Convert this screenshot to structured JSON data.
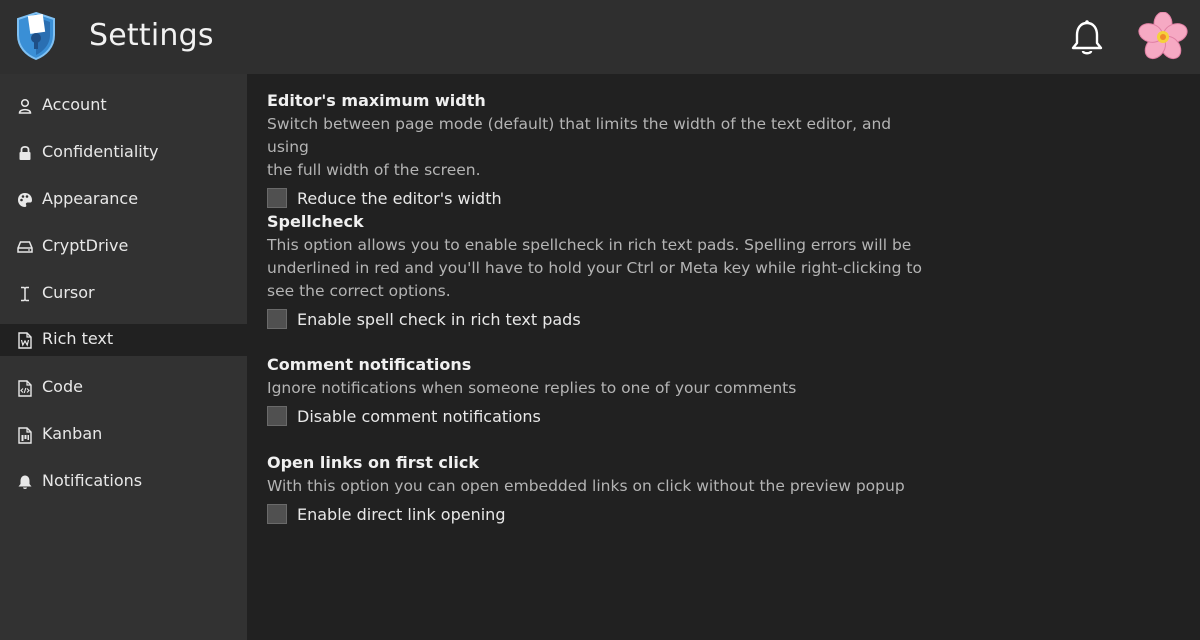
{
  "header": {
    "title": "Settings",
    "logo_icon": "cryptpad-shield-icon",
    "notifications_icon": "bell-icon",
    "avatar_icon": "cherry-blossom-avatar"
  },
  "sidebar": {
    "active_index": 5,
    "items": [
      {
        "label": "Account",
        "icon": "user-icon"
      },
      {
        "label": "Confidentiality",
        "icon": "lock-icon"
      },
      {
        "label": "Appearance",
        "icon": "palette-icon"
      },
      {
        "label": "CryptDrive",
        "icon": "drive-icon"
      },
      {
        "label": "Cursor",
        "icon": "text-cursor-icon"
      },
      {
        "label": "Rich text",
        "icon": "rich-text-file-icon"
      },
      {
        "label": "Code",
        "icon": "code-file-icon"
      },
      {
        "label": "Kanban",
        "icon": "kanban-file-icon"
      },
      {
        "label": "Notifications",
        "icon": "bell-icon"
      }
    ]
  },
  "main": {
    "sections": [
      {
        "title": "Editor's maximum width",
        "description_lines": [
          "Switch between page mode (default) that limits the width of the text editor, and using",
          "the full width of the screen."
        ],
        "checkbox_label": "Reduce the editor's width",
        "checked": false
      },
      {
        "title": "Spellcheck",
        "description_lines": [
          "This option allows you to enable spellcheck in rich text pads. Spelling errors will be",
          "underlined in red and you'll have to hold your Ctrl or Meta key while right-clicking to",
          "see the correct options."
        ],
        "checkbox_label": "Enable spell check in rich text pads",
        "checked": false
      },
      {
        "title": "Comment notifications",
        "description_lines": [
          "Ignore notifications when someone replies to one of your comments"
        ],
        "checkbox_label": "Disable comment notifications",
        "checked": false
      },
      {
        "title": "Open links on first click",
        "description_lines": [
          "With this option you can open embedded links on click without the preview popup"
        ],
        "checkbox_label": "Enable direct link opening",
        "checked": false
      }
    ]
  },
  "colors": {
    "header_bg": "#2f2f2f",
    "sidebar_bg": "#323232",
    "content_bg": "#212121",
    "brand_blue": "#3a8fd6"
  }
}
